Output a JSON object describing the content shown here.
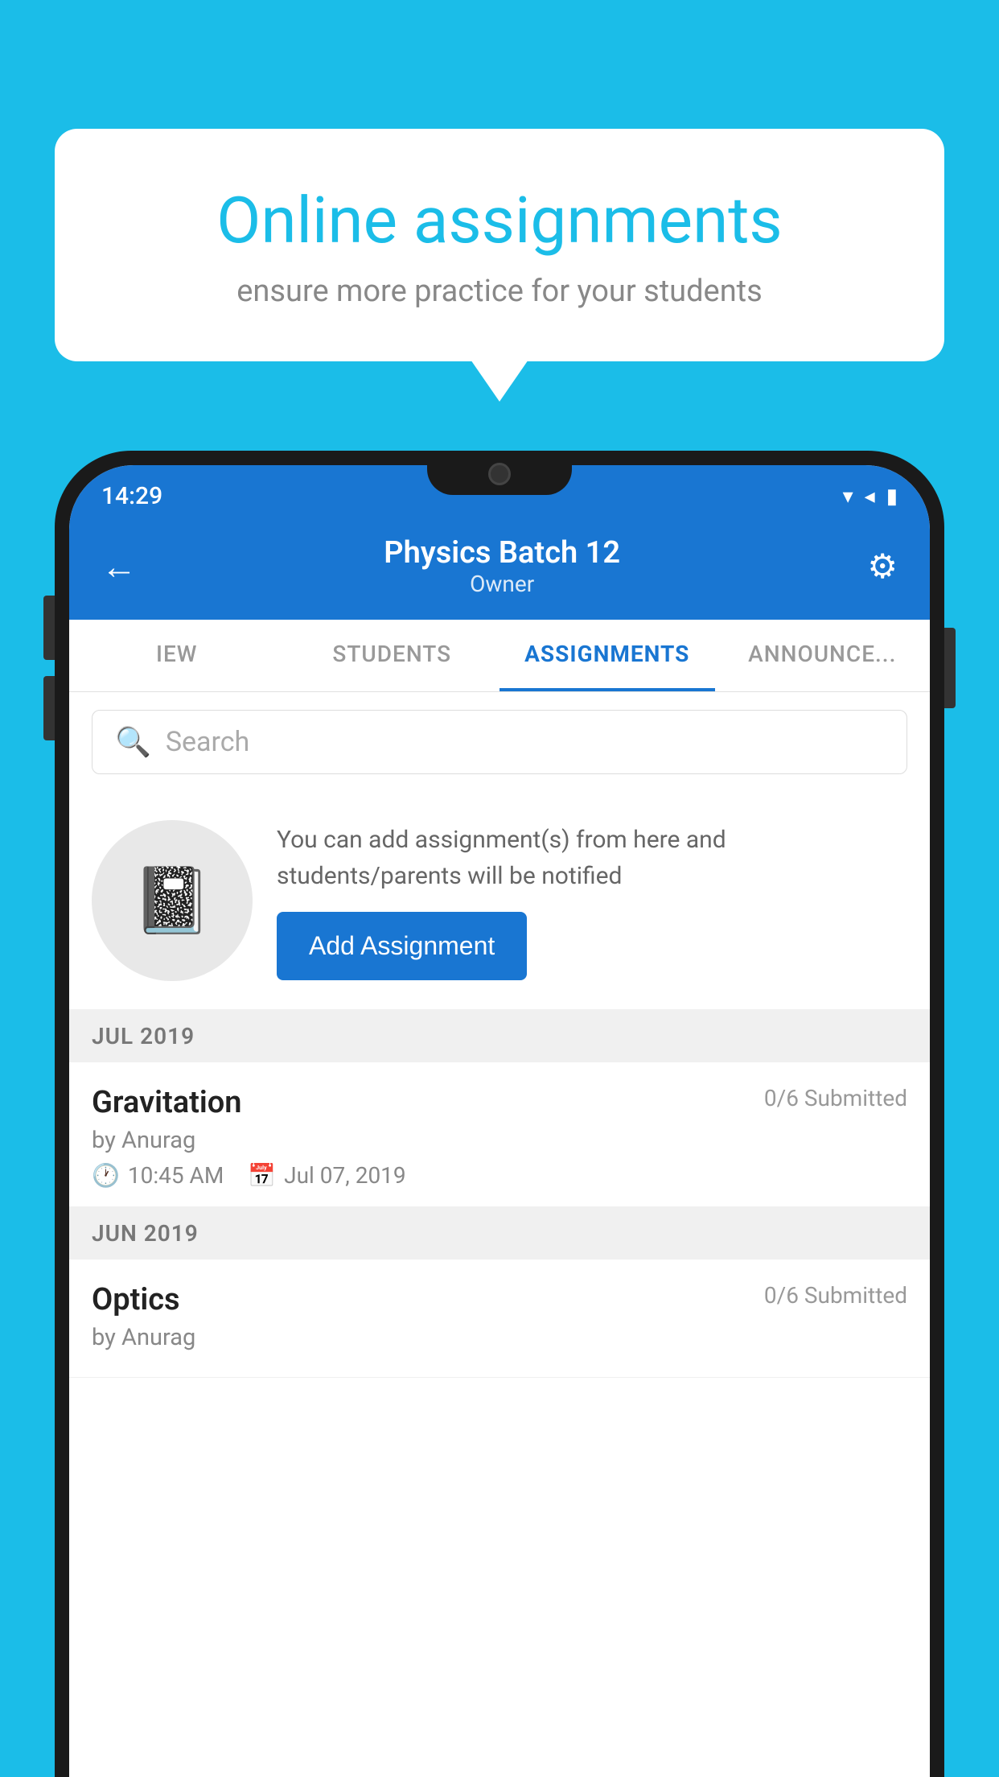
{
  "background_color": "#1BBDE8",
  "speech_bubble": {
    "title": "Online assignments",
    "subtitle": "ensure more practice for your students"
  },
  "status_bar": {
    "time": "14:29",
    "wifi": "▾",
    "signal": "▴",
    "battery": "▮"
  },
  "header": {
    "title": "Physics Batch 12",
    "subtitle": "Owner",
    "back_label": "←",
    "settings_label": "⚙"
  },
  "tabs": [
    {
      "label": "IEW",
      "active": false
    },
    {
      "label": "STUDENTS",
      "active": false
    },
    {
      "label": "ASSIGNMENTS",
      "active": true
    },
    {
      "label": "ANNOUNCEMENTS",
      "active": false
    }
  ],
  "search": {
    "placeholder": "Search"
  },
  "assignment_prompt": {
    "description": "You can add assignment(s) from here and students/parents will be notified",
    "button_label": "Add Assignment"
  },
  "sections": [
    {
      "month_label": "JUL 2019",
      "assignments": [
        {
          "name": "Gravitation",
          "submitted": "0/6 Submitted",
          "by": "by Anurag",
          "time": "10:45 AM",
          "date": "Jul 07, 2019"
        }
      ]
    },
    {
      "month_label": "JUN 2019",
      "assignments": [
        {
          "name": "Optics",
          "submitted": "0/6 Submitted",
          "by": "by Anurag",
          "time": "",
          "date": ""
        }
      ]
    }
  ]
}
